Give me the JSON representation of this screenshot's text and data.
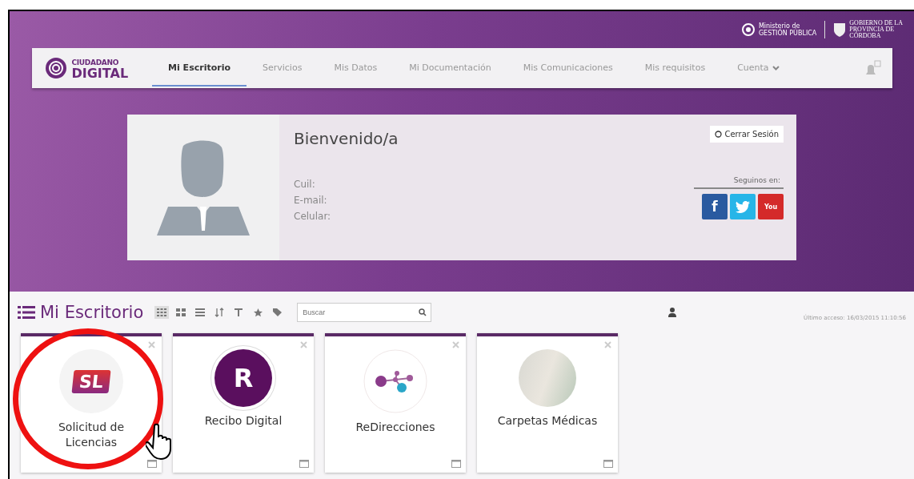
{
  "header": {
    "ministry_logo": [
      "Ministerio de",
      "GESTIÓN PÚBLICA"
    ],
    "government_logo": [
      "GOBIERNO DE LA",
      "PROVINCIA DE",
      "CÓRDOBA"
    ]
  },
  "nav": {
    "logo": [
      "CIUDADANO",
      "DIGITAL"
    ],
    "items": [
      {
        "label": "Mi Escritorio",
        "selected": true
      },
      {
        "label": "Servicios",
        "selected": false
      },
      {
        "label": "Mis Datos",
        "selected": false
      },
      {
        "label": "Mi Documentación",
        "selected": false
      },
      {
        "label": "Mis Comunicaciones",
        "selected": false
      },
      {
        "label": "Mis requisitos",
        "selected": false
      },
      {
        "label": "Cuenta",
        "selected": false,
        "dropdown": true
      }
    ]
  },
  "profile": {
    "greeting": "Bienvenido/a",
    "logout": "Cerrar Sesión",
    "fields": [
      "Cuil:",
      "E-mail:",
      "Celular:"
    ],
    "follow_label": "Seguinos en:",
    "social": [
      {
        "kind": "facebook",
        "label": "f",
        "color": "#2a5aa0"
      },
      {
        "kind": "twitter",
        "color": "#27b5e8"
      },
      {
        "kind": "youtube",
        "label": "You",
        "color": "#d42a2a"
      }
    ]
  },
  "desk": {
    "title": "Mi Escritorio",
    "search_placeholder": "Buscar",
    "last_access": "Último acceso: 16/03/2015 11:10:56",
    "tiles": [
      {
        "kind": "sl",
        "title": "Solicitud de Licencias",
        "icon_text": "SL",
        "highlighted": true
      },
      {
        "kind": "r",
        "title": "Recibo Digital",
        "icon_text": "R",
        "highlighted": false
      },
      {
        "kind": "network",
        "title": "ReDirecciones",
        "highlighted": false
      },
      {
        "kind": "photo",
        "title": "Carpetas Médicas",
        "highlighted": false
      }
    ]
  }
}
